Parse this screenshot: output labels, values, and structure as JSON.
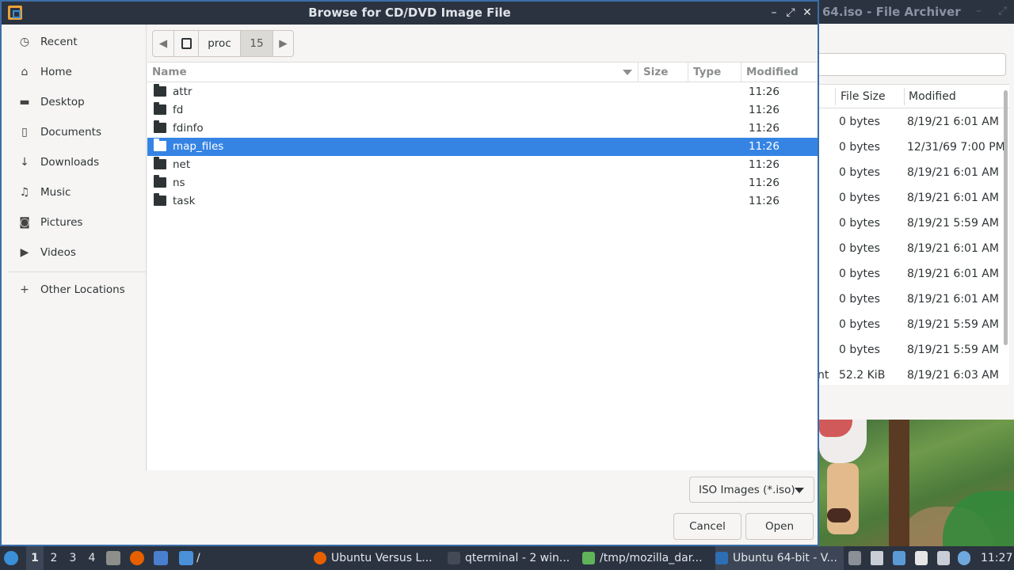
{
  "dialog": {
    "title": "Browse for CD/DVD Image File",
    "window_buttons": [
      "–",
      "⤢",
      "✕"
    ]
  },
  "sidebar": {
    "items": [
      {
        "label": "Recent",
        "icon": "clock-icon"
      },
      {
        "label": "Home",
        "icon": "home-icon"
      },
      {
        "label": "Desktop",
        "icon": "desktop-icon"
      },
      {
        "label": "Documents",
        "icon": "document-icon"
      },
      {
        "label": "Downloads",
        "icon": "download-icon"
      },
      {
        "label": "Music",
        "icon": "music-icon"
      },
      {
        "label": "Pictures",
        "icon": "camera-icon"
      },
      {
        "label": "Videos",
        "icon": "video-icon"
      }
    ],
    "other_locations": "Other Locations"
  },
  "pathbar": {
    "segments": [
      "proc",
      "15"
    ]
  },
  "filelist": {
    "columns": {
      "name": "Name",
      "size": "Size",
      "type": "Type",
      "modified": "Modified"
    },
    "rows": [
      {
        "name": "attr",
        "modified": "11:26",
        "selected": false
      },
      {
        "name": "fd",
        "modified": "11:26",
        "selected": false
      },
      {
        "name": "fdinfo",
        "modified": "11:26",
        "selected": false
      },
      {
        "name": "map_files",
        "modified": "11:26",
        "selected": true
      },
      {
        "name": "net",
        "modified": "11:26",
        "selected": false
      },
      {
        "name": "ns",
        "modified": "11:26",
        "selected": false
      },
      {
        "name": "task",
        "modified": "11:26",
        "selected": false
      }
    ]
  },
  "filter": {
    "label": "ISO Images (*.iso)"
  },
  "buttons": {
    "cancel": "Cancel",
    "open": "Open"
  },
  "background_window": {
    "title": "64.iso - File Archiver",
    "columns": {
      "size": "File Size",
      "modified": "Modified"
    },
    "rows": [
      {
        "prefix": "",
        "size": "0 bytes",
        "modified": "8/19/21 6:01 AM"
      },
      {
        "prefix": "",
        "size": "0 bytes",
        "modified": "12/31/69 7:00 PM"
      },
      {
        "prefix": "",
        "size": "0 bytes",
        "modified": "8/19/21 6:01 AM"
      },
      {
        "prefix": "",
        "size": "0 bytes",
        "modified": "8/19/21 6:01 AM"
      },
      {
        "prefix": "",
        "size": "0 bytes",
        "modified": "8/19/21 5:59 AM"
      },
      {
        "prefix": "",
        "size": "0 bytes",
        "modified": "8/19/21 6:01 AM"
      },
      {
        "prefix": "",
        "size": "0 bytes",
        "modified": "8/19/21 6:01 AM"
      },
      {
        "prefix": "",
        "size": "0 bytes",
        "modified": "8/19/21 6:01 AM"
      },
      {
        "prefix": "",
        "size": "0 bytes",
        "modified": "8/19/21 5:59 AM"
      },
      {
        "prefix": "",
        "size": "0 bytes",
        "modified": "8/19/21 5:59 AM"
      },
      {
        "prefix": "nt",
        "size": "52.2 KiB",
        "modified": "8/19/21 6:03 AM"
      }
    ]
  },
  "taskbar": {
    "workspaces": [
      "1",
      "2",
      "3",
      "4"
    ],
    "path_label": "/",
    "tasks": [
      {
        "label": "Ubuntu Versus L...",
        "icon": "firefox-icon",
        "color": "#e66000"
      },
      {
        "label": "qterminal - 2 win...",
        "icon": "terminal-icon",
        "color": "#444b57"
      },
      {
        "label": "/tmp/mozilla_dar...",
        "icon": "archive-icon",
        "color": "#5fb45a"
      },
      {
        "label": "Ubuntu 64-bit - V...",
        "icon": "virtualbox-icon",
        "color": "#2d6eb5"
      }
    ],
    "clock": "11:27"
  },
  "colors": {
    "selection": "#3584e4",
    "titlebar": "#2b3340",
    "window_bg": "#f6f5f4"
  }
}
